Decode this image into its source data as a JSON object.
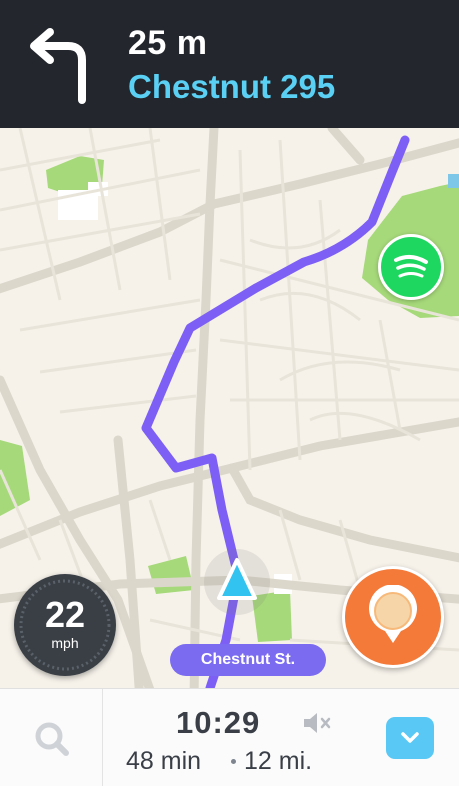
{
  "navigation": {
    "turn_direction": "left",
    "distance": "25 m",
    "street": "Chestnut 295"
  },
  "map": {
    "current_street": "Chestnut St."
  },
  "speedometer": {
    "speed": "22",
    "unit": "mph"
  },
  "eta": {
    "arrival_time": "10:29",
    "duration": "48 min",
    "distance": "12 mi."
  },
  "icons": {
    "turn": "turn-left-arrow-icon",
    "music": "spotify-icon",
    "report": "report-pin-icon",
    "search": "search-icon",
    "sound": "mute-icon",
    "expand": "chevron-down-icon",
    "car": "car-position-arrow-icon"
  },
  "colors": {
    "top_bar": "#23272d",
    "street_name": "#5ad0f4",
    "route": "#7e5ff5",
    "parks": "#a6d97a",
    "spotify": "#1ed760",
    "report": "#f47a3a",
    "car": "#33c3f0",
    "street_pill": "#7a6bf0",
    "expand_button": "#5ac8f5"
  }
}
